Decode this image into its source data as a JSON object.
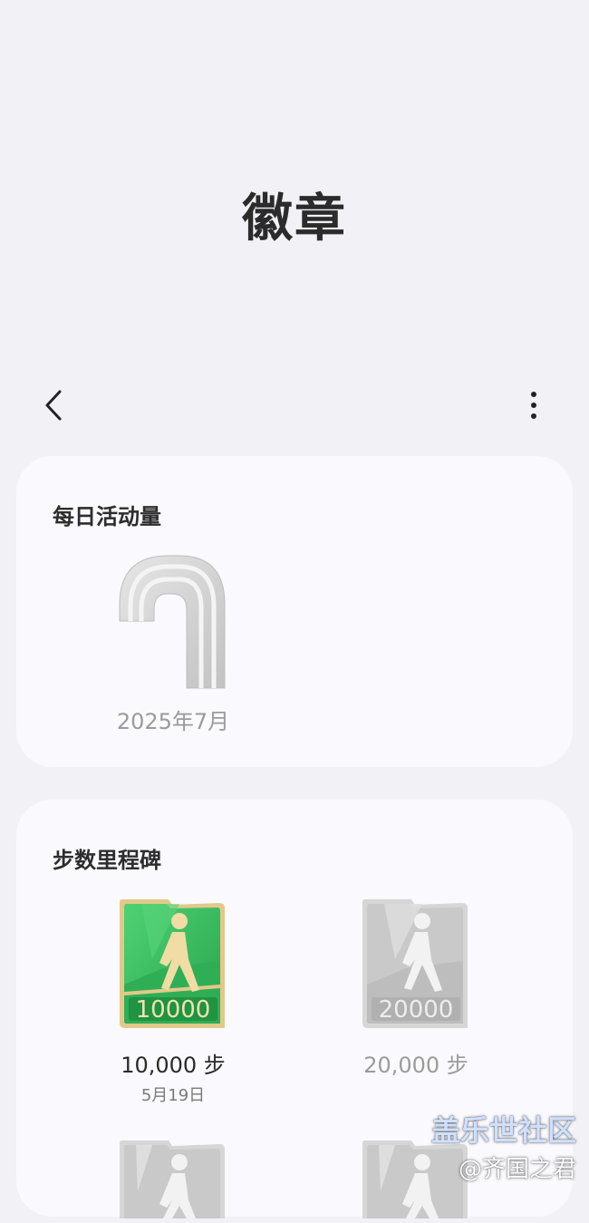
{
  "header": {
    "title": "徽章"
  },
  "toolbar": {
    "back_icon": "chevron-left-icon",
    "more_icon": "more-vertical-icon"
  },
  "sections": {
    "daily_activity": {
      "title": "每日活动量",
      "badges": [
        {
          "label": "2025年7月",
          "icon": "activity-arch-badge-icon",
          "earned": false
        }
      ]
    },
    "step_milestones": {
      "title": "步数里程碑",
      "badges": [
        {
          "label": "10,000 步",
          "date": "5月19日",
          "number": "10000",
          "icon": "walking-person-badge-icon",
          "earned": true
        },
        {
          "label": "20,000 步",
          "date": "",
          "number": "20000",
          "icon": "walking-person-badge-icon",
          "earned": false
        },
        {
          "label": "",
          "date": "",
          "number": "",
          "icon": "walking-person-badge-icon",
          "earned": false
        },
        {
          "label": "",
          "date": "",
          "number": "",
          "icon": "walking-person-badge-icon",
          "earned": false
        }
      ]
    }
  },
  "watermark": {
    "line1": "盖乐世社区",
    "line2": "@齐国之君"
  },
  "colors": {
    "background": "#f2f1f6",
    "card": "#faf9fd",
    "earned_green": "#37b85c",
    "earned_gold": "#e2c98a",
    "locked_gray": "#c9c9c9"
  }
}
